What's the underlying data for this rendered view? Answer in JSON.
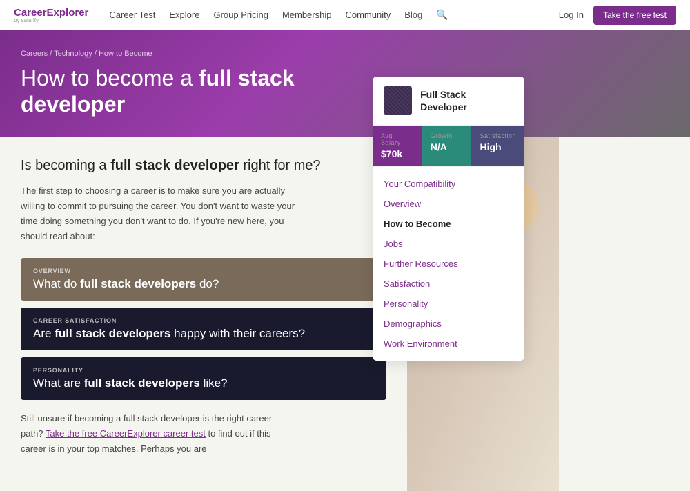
{
  "nav": {
    "logo": "CareerExplorer",
    "logo_sub": "by salarify",
    "links": [
      "Career Test",
      "Explore",
      "Group Pricing",
      "Membership",
      "Community",
      "Blog"
    ],
    "login": "Log In",
    "cta": "Take the free test"
  },
  "breadcrumb": {
    "items": [
      "Careers",
      "Technology",
      "How to Become"
    ]
  },
  "hero": {
    "title_prefix": "How to become a ",
    "title_main": "full stack developer"
  },
  "sidebar": {
    "career_title": "Full Stack Developer",
    "stats": [
      {
        "label": "Avg Salary",
        "value": "$70k",
        "type": "salary"
      },
      {
        "label": "Growth",
        "value": "N/A",
        "type": "growth"
      },
      {
        "label": "Satisfaction",
        "value": "High",
        "type": "satisfaction"
      }
    ],
    "nav_items": [
      {
        "label": "Your Compatibility",
        "active": false
      },
      {
        "label": "Overview",
        "active": false
      },
      {
        "label": "How to Become",
        "active": true
      },
      {
        "label": "Jobs",
        "active": false
      },
      {
        "label": "Further Resources",
        "active": false
      },
      {
        "label": "Satisfaction",
        "active": false
      },
      {
        "label": "Personality",
        "active": false
      },
      {
        "label": "Demographics",
        "active": false
      },
      {
        "label": "Work Environment",
        "active": false
      }
    ]
  },
  "content": {
    "section_title_prefix": "Is becoming a ",
    "section_title_main": "full stack developer",
    "section_title_suffix": " right for me?",
    "body_text": "The first step to choosing a career is to make sure you are actually willing to commit to pursuing the career. You don't want to waste your time doing something you don't want to do. If you're new here, you should read about:",
    "cards": [
      {
        "label": "OVERVIEW",
        "title_prefix": "What do ",
        "title_main": "full stack developers",
        "title_suffix": " do?",
        "type": "overview"
      },
      {
        "label": "CAREER SATISFACTION",
        "title_prefix": "Are ",
        "title_main": "full stack developers",
        "title_suffix": " happy with their careers?",
        "type": "satisfaction"
      },
      {
        "label": "PERSONALITY",
        "title_prefix": "What are ",
        "title_main": "full stack developers",
        "title_suffix": " like?",
        "type": "personality"
      }
    ],
    "footer_text": "Still unsure if becoming a full stack developer is the right career path? ",
    "footer_link": "Take the free CareerExplorer career test",
    "footer_text2": " to find out if this career is in your top matches. Perhaps you are"
  }
}
